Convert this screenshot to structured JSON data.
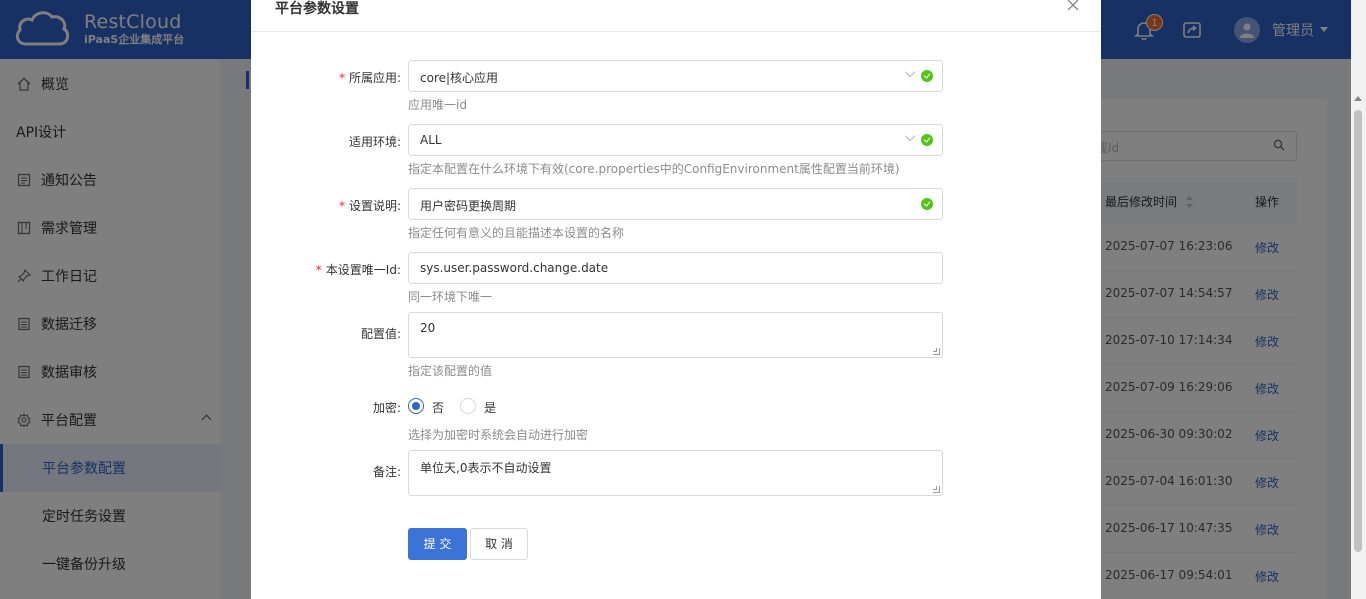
{
  "header": {
    "brand_title": "RestCloud",
    "brand_subtitle": "iPaaS企业集成平台",
    "notification_count": "1",
    "user_name": "管理员"
  },
  "sidebar": {
    "items": [
      {
        "label": "概览",
        "icon": "home-icon"
      },
      {
        "label": "API设计",
        "icon": ""
      },
      {
        "label": "通知公告",
        "icon": "notice-icon"
      },
      {
        "label": "需求管理",
        "icon": "board-icon"
      },
      {
        "label": "工作日记",
        "icon": "pin-icon"
      },
      {
        "label": "数据迁移",
        "icon": "list-icon"
      },
      {
        "label": "数据审核",
        "icon": "list-icon"
      },
      {
        "label": "平台配置",
        "icon": "gear-icon"
      },
      {
        "label": "平台参数配置",
        "icon": ""
      },
      {
        "label": "定时任务设置",
        "icon": ""
      },
      {
        "label": "一键备份升级",
        "icon": ""
      }
    ]
  },
  "background_table": {
    "search_placeholder": "或Id",
    "columns": {
      "modified_time": "最后修改时间",
      "operation": "操作"
    },
    "rows": [
      {
        "time": "2025-07-07 16:23:06",
        "action": "修改"
      },
      {
        "time": "2025-07-07 14:54:57",
        "action": "修改"
      },
      {
        "time": "2025-07-10 17:14:34",
        "action": "修改"
      },
      {
        "time": "2025-07-09 16:29:06",
        "action": "修改"
      },
      {
        "time": "2025-06-30 09:30:02",
        "action": "修改"
      },
      {
        "time": "2025-07-04 16:01:30",
        "action": "修改"
      },
      {
        "time": "2025-06-17 10:47:35",
        "action": "修改"
      },
      {
        "time": "2025-06-17 09:54:01",
        "action": "修改"
      }
    ]
  },
  "dialog": {
    "title": "平台参数设置",
    "fields": {
      "app": {
        "label": "所属应用:",
        "value": "core|核心应用",
        "help": "应用唯一id"
      },
      "env": {
        "label": "适用环境:",
        "value": "ALL",
        "help": "指定本配置在什么环境下有效(core.properties中的ConfigEnvironment属性配置当前环境)"
      },
      "desc": {
        "label": "设置说明:",
        "value": "用户密码更换周期",
        "help": "指定任何有意义的且能描述本设置的名称"
      },
      "key": {
        "label": "本设置唯一Id:",
        "value": "sys.user.password.change.date",
        "help": "同一环境下唯一"
      },
      "value": {
        "label": "配置值:",
        "value": "20",
        "help": "指定该配置的值"
      },
      "encrypt": {
        "label": "加密:",
        "option_no": "否",
        "option_yes": "是",
        "selected": "否",
        "help": "选择为加密时系统会自动进行加密"
      },
      "remark": {
        "label": "备注:",
        "value": "单位天,0表示不自动设置"
      }
    },
    "submit_label": "提 交",
    "cancel_label": "取 消"
  }
}
